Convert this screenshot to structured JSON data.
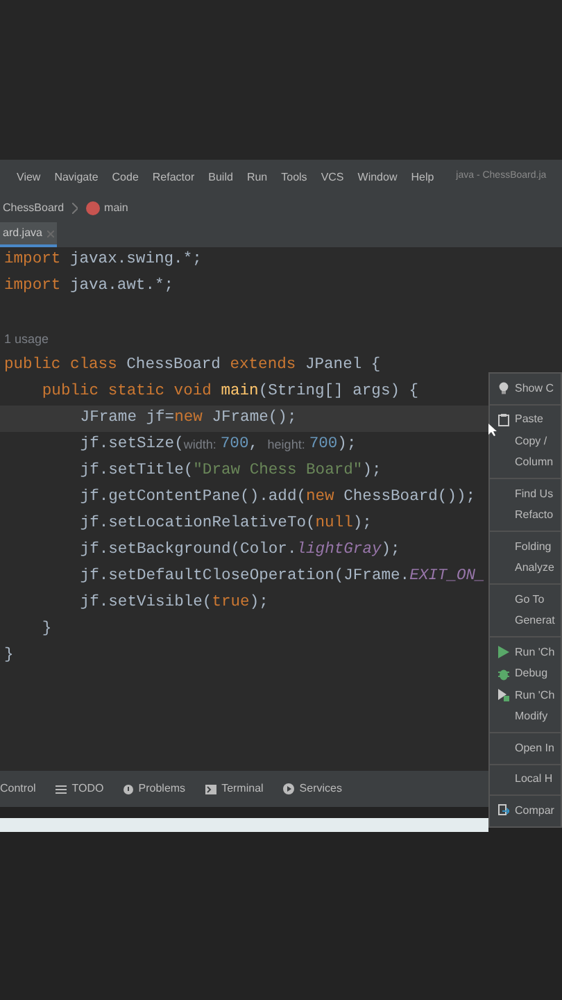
{
  "menu_bar": {
    "items": [
      "View",
      "Navigate",
      "Code",
      "Refactor",
      "Build",
      "Run",
      "Tools",
      "VCS",
      "Window",
      "Help"
    ],
    "title": "java - ChessBoard.ja"
  },
  "breadcrumb": [
    {
      "label": "ChessBoard",
      "kind": "class"
    },
    {
      "label": "main",
      "kind": "method"
    }
  ],
  "tabs": [
    {
      "label": "ard.java",
      "selected": true
    }
  ],
  "editor": {
    "lines": [
      {
        "kind": "code",
        "current": false,
        "tokens": [
          {
            "kind": "kw",
            "text": "import"
          },
          {
            "kind": "plain",
            "text": " javax.swing.*;"
          }
        ]
      },
      {
        "kind": "code",
        "current": false,
        "tokens": [
          {
            "kind": "kw",
            "text": "import"
          },
          {
            "kind": "plain",
            "text": " java.awt.*;"
          }
        ]
      },
      {
        "kind": "blank",
        "current": false
      },
      {
        "kind": "code",
        "current": false,
        "tokens": [
          {
            "kind": "usage",
            "text": "1 usage"
          }
        ]
      },
      {
        "kind": "code",
        "current": false,
        "tokens": [
          {
            "kind": "kw",
            "text": "public class"
          },
          {
            "kind": "plain",
            "text": " ChessBoard "
          },
          {
            "kind": "kw",
            "text": "extends"
          },
          {
            "kind": "plain",
            "text": " JPanel {"
          }
        ],
        "children": [
          {
            "kind": "code",
            "current": false,
            "tokens": [
              {
                "kind": "kw",
                "text": "public static void"
              },
              {
                "kind": "fn",
                "text": " main"
              },
              {
                "kind": "plain",
                "text": "(String[] args) {"
              }
            ],
            "children": [
              {
                "kind": "code",
                "current": true,
                "tokens": [
                  {
                    "kind": "plain",
                    "text": "JFrame jf="
                  },
                  {
                    "kind": "kw",
                    "text": "new"
                  },
                  {
                    "kind": "plain",
                    "text": " JFrame();"
                  }
                ]
              },
              {
                "kind": "code",
                "current": false,
                "tokens": [
                  {
                    "kind": "plain",
                    "text": "jf.setSize("
                  },
                  {
                    "kind": "hint",
                    "text": "width:"
                  },
                  {
                    "kind": "num",
                    "text": "700"
                  },
                  {
                    "kind": "plain",
                    "text": ", "
                  },
                  {
                    "kind": "hint",
                    "text": "height:"
                  },
                  {
                    "kind": "num",
                    "text": "700"
                  },
                  {
                    "kind": "plain",
                    "text": ");"
                  }
                ]
              },
              {
                "kind": "code",
                "current": false,
                "tokens": [
                  {
                    "kind": "plain",
                    "text": "jf.setTitle("
                  },
                  {
                    "kind": "str",
                    "text": "\"Draw Chess Board\""
                  },
                  {
                    "kind": "plain",
                    "text": ");"
                  }
                ]
              },
              {
                "kind": "code",
                "current": false,
                "tokens": [
                  {
                    "kind": "plain",
                    "text": "jf.getContentPane().add("
                  },
                  {
                    "kind": "kw",
                    "text": "new"
                  },
                  {
                    "kind": "plain",
                    "text": " ChessBoard());"
                  }
                ]
              },
              {
                "kind": "code",
                "current": false,
                "tokens": [
                  {
                    "kind": "plain",
                    "text": "jf.setLocationRelativeTo("
                  },
                  {
                    "kind": "kw",
                    "text": "null"
                  },
                  {
                    "kind": "plain",
                    "text": ");"
                  }
                ]
              },
              {
                "kind": "code",
                "current": false,
                "tokens": [
                  {
                    "kind": "plain",
                    "text": "jf.setBackground(Color."
                  },
                  {
                    "kind": "const",
                    "text": "lightGray"
                  },
                  {
                    "kind": "plain",
                    "text": ");"
                  }
                ]
              },
              {
                "kind": "code",
                "current": false,
                "tokens": [
                  {
                    "kind": "plain",
                    "text": "jf.setDefaultCloseOperation(JFrame."
                  },
                  {
                    "kind": "const",
                    "text": "EXIT_ON_"
                  }
                ]
              },
              {
                "kind": "code",
                "current": false,
                "tokens": [
                  {
                    "kind": "plain",
                    "text": "jf.setVisible("
                  },
                  {
                    "kind": "kw",
                    "text": "true"
                  },
                  {
                    "kind": "plain",
                    "text": ");"
                  }
                ]
              }
            ]
          },
          {
            "kind": "code",
            "current": false,
            "tokens": [
              {
                "kind": "plain",
                "text": "}"
              }
            ]
          }
        ]
      },
      {
        "kind": "code",
        "current": false,
        "tokens": [
          {
            "kind": "plain",
            "text": "}"
          }
        ]
      }
    ]
  },
  "context_menu": {
    "groups": [
      [
        {
          "label": "Show C",
          "kind": "bulb"
        }
      ],
      [
        {
          "label": "Paste",
          "kind": "clipboard"
        },
        {
          "label": "Copy /",
          "kind": "plain"
        },
        {
          "label": "Column",
          "kind": "plain"
        }
      ],
      [
        {
          "label": "Find Us",
          "kind": "plain"
        },
        {
          "label": "Refacto",
          "kind": "plain"
        }
      ],
      [
        {
          "label": "Folding",
          "kind": "plain"
        },
        {
          "label": "Analyze",
          "kind": "plain"
        }
      ],
      [
        {
          "label": "Go To",
          "kind": "plain"
        },
        {
          "label": "Generat",
          "kind": "plain"
        }
      ],
      [
        {
          "label": "Run 'Ch",
          "kind": "run"
        },
        {
          "label": "Debug",
          "kind": "debug"
        },
        {
          "label": "Run 'Ch",
          "kind": "coverage"
        },
        {
          "label": "Modify",
          "kind": "plain"
        }
      ],
      [
        {
          "label": "Open In",
          "kind": "plain"
        }
      ],
      [
        {
          "label": "Local H",
          "kind": "plain"
        }
      ],
      [
        {
          "label": "Compar",
          "kind": "compare"
        }
      ]
    ]
  },
  "tool_bar": [
    {
      "label": "Control",
      "kind": "plain"
    },
    {
      "label": "TODO",
      "kind": "list"
    },
    {
      "label": "Problems",
      "kind": "info"
    },
    {
      "label": "Terminal",
      "kind": "terminal"
    },
    {
      "label": "Services",
      "kind": "services"
    }
  ]
}
